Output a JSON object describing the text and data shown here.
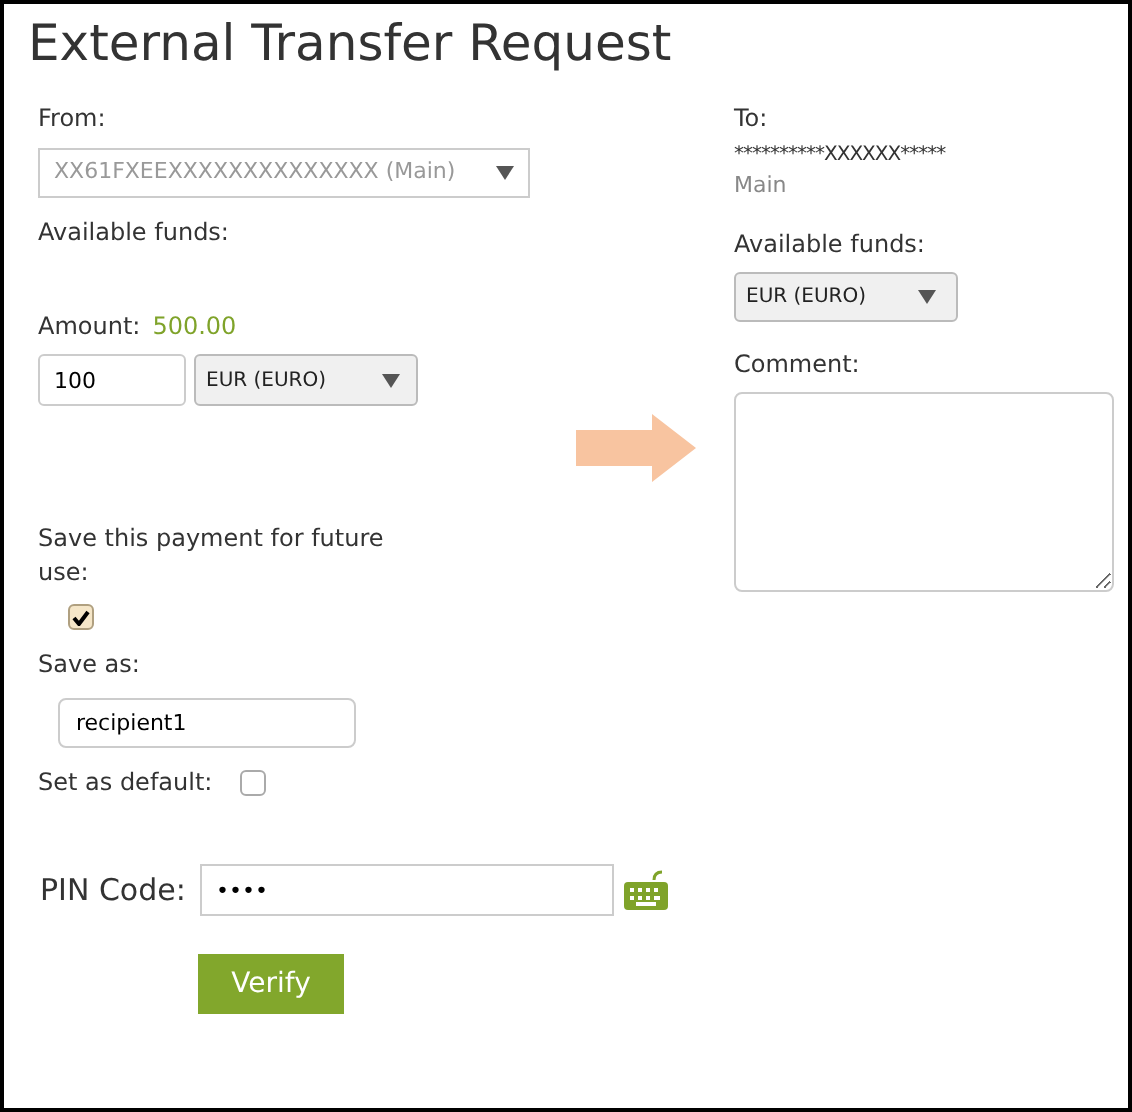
{
  "title": "External Transfer Request",
  "from": {
    "label": "From:",
    "account": "XX61FXEEXXXXXXXXXXXXXX (Main)",
    "available_label": "Available funds:"
  },
  "amount": {
    "label": "Amount:",
    "available": "500.00",
    "value": "100",
    "currency": "EUR (EURO)"
  },
  "save_payment": {
    "label": "Save this payment for future use:",
    "checked": true
  },
  "save_as": {
    "label": "Save as:",
    "value": "recipient1"
  },
  "set_default": {
    "label": "Set as default:",
    "checked": false
  },
  "pin": {
    "label": "PIN Code:",
    "value": "••••"
  },
  "verify_button": "Verify",
  "to": {
    "label": "To:",
    "account_masked": "**********XXXXXX*****",
    "account_name": "Main",
    "available_label": "Available funds:",
    "currency": "EUR (EURO)"
  },
  "comment": {
    "label": "Comment:"
  }
}
